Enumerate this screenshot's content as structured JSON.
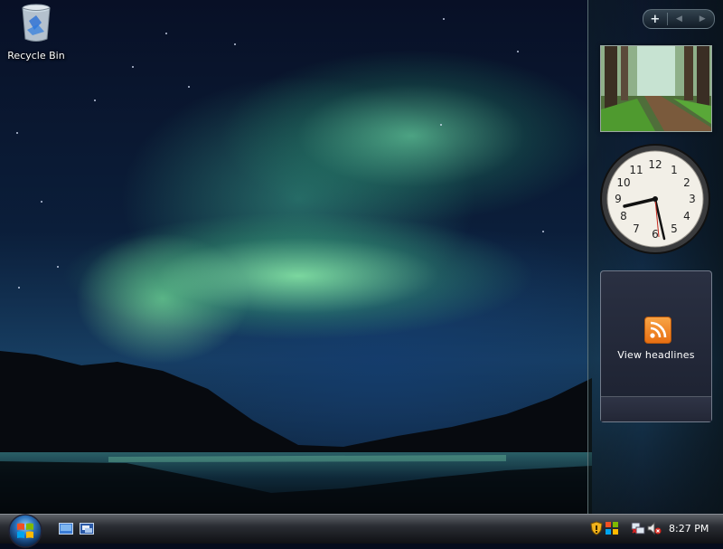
{
  "desktop": {
    "icons": [
      {
        "label": "Recycle Bin",
        "icon": "recycle-bin-icon"
      }
    ]
  },
  "sidebar": {
    "controls": {
      "add": "+",
      "prev": "◀",
      "next": "▶"
    },
    "gadgets": {
      "slideshow": {
        "icon": "forest-photo"
      },
      "clock": {
        "time": "8:27",
        "numerals": [
          "12",
          "1",
          "2",
          "3",
          "4",
          "5",
          "6",
          "7",
          "8",
          "9",
          "10",
          "11"
        ]
      },
      "feed": {
        "label": "View headlines",
        "icon": "rss-icon"
      }
    }
  },
  "taskbar": {
    "start_icon": "windows-logo-icon",
    "quick_launch": [
      {
        "name": "show-desktop-icon"
      },
      {
        "name": "switch-windows-icon"
      }
    ],
    "tray": {
      "icons": [
        "security-shield-icon",
        "windows-update-icon",
        "network-icon",
        "volume-muted-icon"
      ],
      "time": "8:27 PM"
    }
  },
  "colors": {
    "aurora": "#7fe6a8",
    "taskbar": "#1a1c21",
    "rss": "#f08a2a"
  }
}
